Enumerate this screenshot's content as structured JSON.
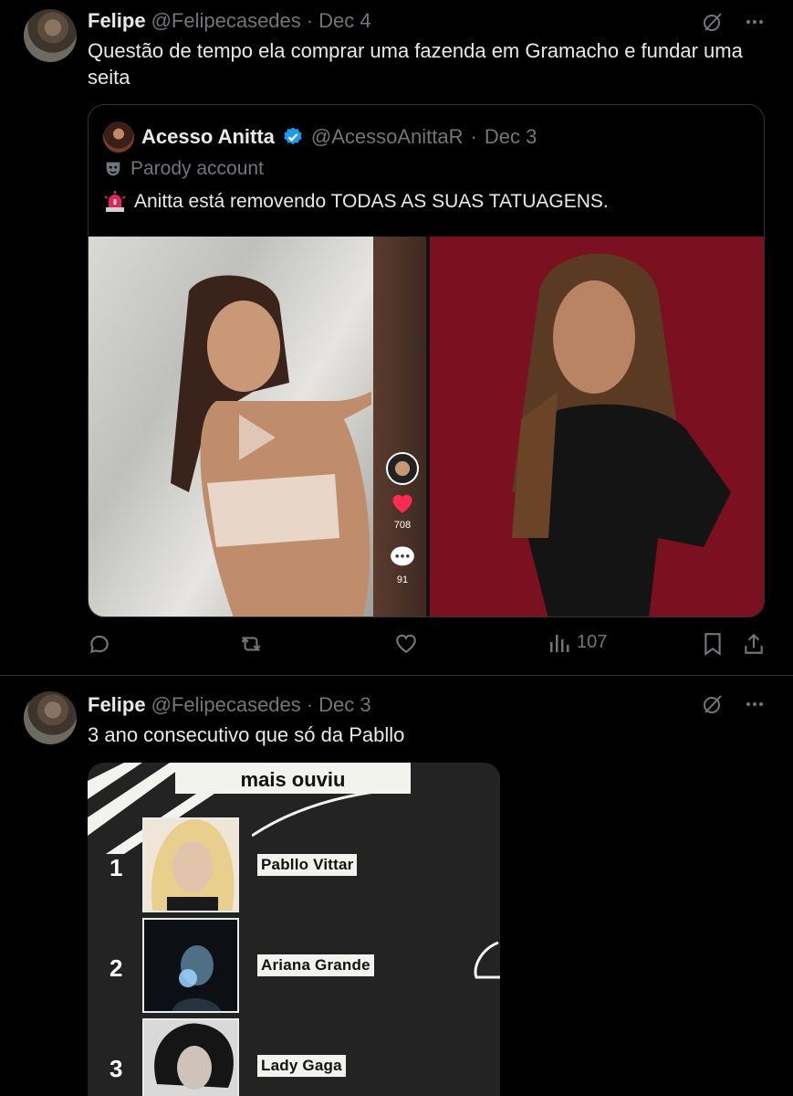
{
  "tweet1": {
    "author_name": "Felipe",
    "handle": "@Felipecasedes",
    "separator": "·",
    "date": "Dec 4",
    "text": "Questão de tempo ela comprar uma fazenda em Gramacho e fundar uma seita",
    "quote": {
      "author_name": "Acesso Anitta",
      "handle": "@AcessoAnittaR",
      "separator": "·",
      "date": "Dec 3",
      "parody_label": "Parody account",
      "text": "Anitta está removendo TODAS AS SUAS TATUAGENS.",
      "video_overlay": {
        "likes": "708",
        "comments": "91"
      }
    },
    "actions": {
      "views": "107"
    }
  },
  "tweet2": {
    "author_name": "Felipe",
    "handle": "@Felipecasedes",
    "separator": "·",
    "date": "Dec 3",
    "text": "3 ano consecutivo que só da Pabllo",
    "image": {
      "banner": "mais ouviu",
      "ranking": [
        {
          "rank": "1",
          "artist": "Pabllo Vittar"
        },
        {
          "rank": "2",
          "artist": "Ariana Grande"
        },
        {
          "rank": "3",
          "artist": "Lady Gaga"
        }
      ]
    }
  },
  "colors": {
    "background": "#000000",
    "text_primary": "#e7e9ea",
    "text_secondary": "#71767b",
    "border": "#2f3336",
    "verified_blue": "#1d9bf0",
    "like_red": "#f91880"
  }
}
